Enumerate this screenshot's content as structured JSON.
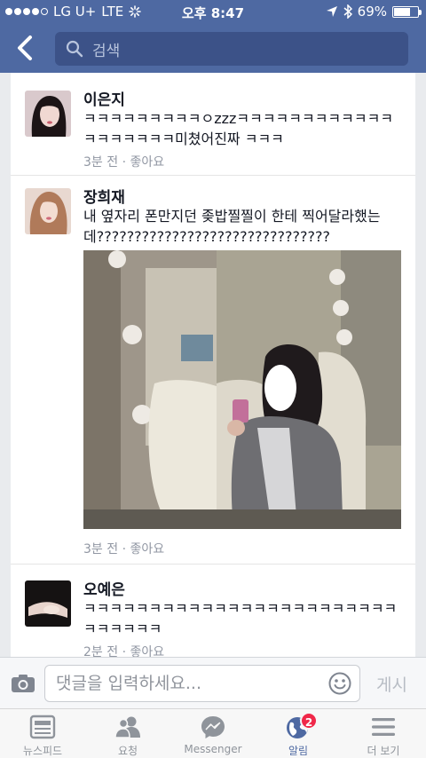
{
  "status_bar": {
    "carrier": "LG U+",
    "network": "LTE",
    "time": "오후 8:47",
    "battery": "69%",
    "battery_level": 0.69
  },
  "header": {
    "search_placeholder": "검색"
  },
  "comments": [
    {
      "name": "이은지",
      "text": "ㅋㅋㅋㅋㅋㅋㅋㅋㅋㅇzzzㅋㅋㅋㅋㅋㅋㅋㅋㅋㅋㅋㅋㅋㅋㅋㅋㅋㅋㅋ미쳤어진짜 ㅋㅋㅋ",
      "time": "3분 전",
      "like": "좋아요"
    },
    {
      "name": "장희재",
      "text": "내 옆자리 폰만지던 좆밥찔찔이 한테 찍어달라했는데???????????????????????????????",
      "time": "3분 전",
      "like": "좋아요"
    },
    {
      "name": "오예은",
      "text": "ㅋㅋㅋㅋㅋㅋㅋㅋㅋㅋㅋㅋㅋㅋㅋㅋㅋㅋㅋㅋㅋㅋㅋㅋㅋㅋㅋㅋㅋㅋ",
      "time": "2분 전",
      "like": "좋아요"
    }
  ],
  "composer": {
    "placeholder": "댓글을 입력하세요...",
    "post_label": "게시"
  },
  "tabs": [
    {
      "label": "뉴스피드",
      "icon": "news-feed-icon"
    },
    {
      "label": "요청",
      "icon": "friend-requests-icon"
    },
    {
      "label": "Messenger",
      "icon": "messenger-icon"
    },
    {
      "label": "알림",
      "icon": "globe-icon",
      "badge": "2",
      "active": true
    },
    {
      "label": "더 보기",
      "icon": "menu-icon"
    }
  ],
  "colors": {
    "header_bg": "#4e69a2",
    "badge": "#f02849"
  }
}
